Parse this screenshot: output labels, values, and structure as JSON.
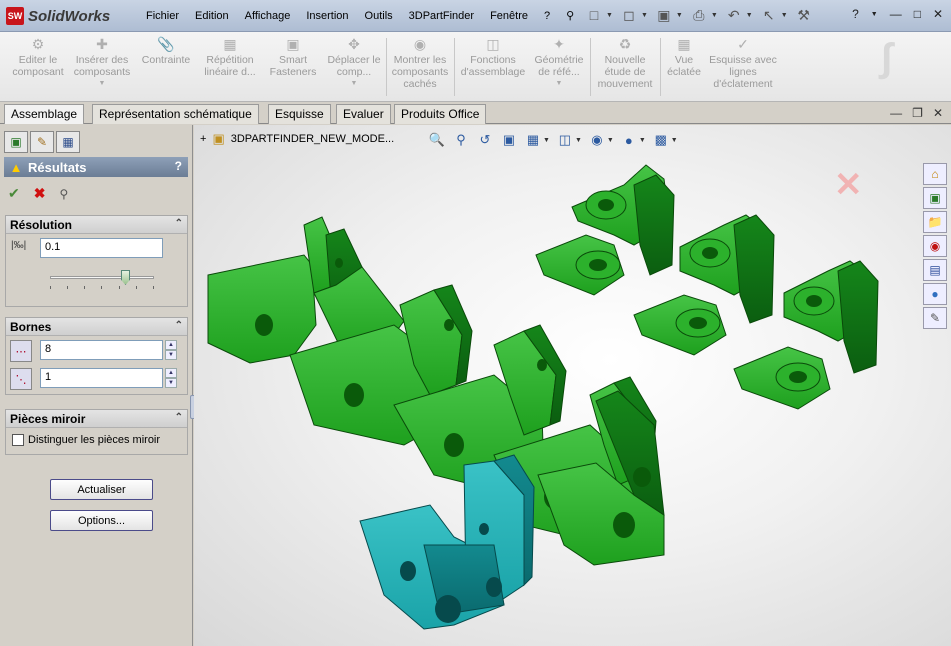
{
  "app": {
    "logo_mark": "SW",
    "logo_text": "SolidWorks",
    "menu": [
      "Fichier",
      "Edition",
      "Affichage",
      "Insertion",
      "Outils",
      "3DPartFinder",
      "Fenêtre",
      "?"
    ],
    "help_label": "?"
  },
  "commands": [
    {
      "label": "Editer le composant",
      "icon": "edit-component-icon"
    },
    {
      "label": "Insérer des composants",
      "icon": "insert-components-icon"
    },
    {
      "label": "Contrainte",
      "icon": "mate-icon"
    },
    {
      "label": "Répétition linéaire d...",
      "icon": "linear-pattern-icon"
    },
    {
      "label": "Smart Fasteners",
      "icon": "smart-fasteners-icon"
    },
    {
      "label": "Déplacer le comp...",
      "icon": "move-component-icon"
    },
    {
      "label": "Montrer les composants cachés",
      "icon": "show-hidden-icon"
    },
    {
      "label": "Fonctions d'assemblage",
      "icon": "assembly-features-icon"
    },
    {
      "label": "Géométrie de réfé...",
      "icon": "reference-geometry-icon"
    },
    {
      "label": "Nouvelle étude de mouvement",
      "icon": "motion-study-icon"
    },
    {
      "label": "Vue éclatée",
      "icon": "exploded-view-icon"
    },
    {
      "label": "Esquisse avec lignes d'éclatement",
      "icon": "explode-line-sketch-icon"
    }
  ],
  "tabs": [
    "Assemblage",
    "Représentation schématique",
    "Esquisse",
    "Evaluer",
    "Produits Office"
  ],
  "panel": {
    "title": "Résultats",
    "help": "?",
    "resolution": {
      "title": "Résolution",
      "value": "0.1",
      "slider_position": 0.75
    },
    "bornes": {
      "title": "Bornes",
      "value1": "8",
      "value2": "1"
    },
    "mirror": {
      "title": "Pièces miroir",
      "checkbox_label": "Distinguer les pièces miroir",
      "checked": false
    },
    "buttons": {
      "update": "Actualiser",
      "options": "Options..."
    }
  },
  "viewport": {
    "document_name": "3DPARTFINDER_NEW_MODE...",
    "colors": {
      "green_part": "#1ea01e",
      "green_dark": "#0d6a0d",
      "cyan_part": "#1aa3a8",
      "cyan_dark": "#0a6a6e"
    }
  }
}
